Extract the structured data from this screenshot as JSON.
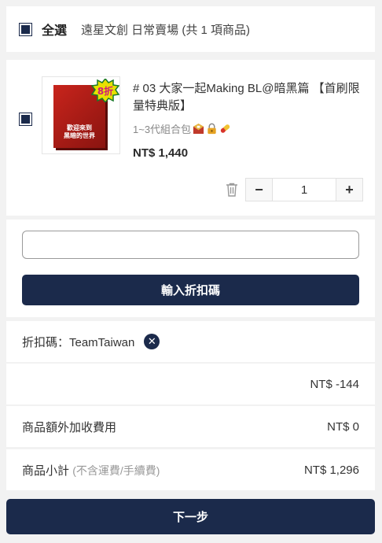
{
  "header": {
    "select_all_label": "全選",
    "shop_info": "遠星文創 日常賣場 (共 1 項商品)"
  },
  "product": {
    "box_text": "歡迎來到\n黑暗的世界",
    "badge": "8折",
    "title": "# 03 大家一起Making BL@暗黑篇 【首刷限量特典版】",
    "variant": "1~3代組合包",
    "variant_icons": [
      "mail-icon",
      "lock-icon",
      "pill-icon"
    ],
    "price": "NT$ 1,440",
    "quantity": "1",
    "minus": "−",
    "plus": "+"
  },
  "coupon": {
    "input_value": "",
    "apply_button": "輸入折扣碼"
  },
  "summary": {
    "code_label": "折扣碼：TeamTaiwan",
    "discount": "NT$ -144",
    "extra_fee_label": "商品額外加收費用",
    "extra_fee_value": "NT$ 0",
    "subtotal_label": "商品小計",
    "subtotal_note": "(不含運費/手續費)",
    "subtotal_value": "NT$ 1,296"
  },
  "footer": {
    "next_button": "下一步"
  },
  "colors": {
    "primary": "#1b2a4b",
    "background": "#f2f2f2"
  }
}
